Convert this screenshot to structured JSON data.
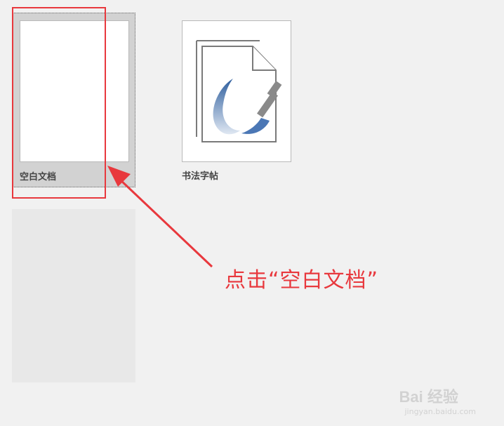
{
  "templates": [
    {
      "label": "空白文档",
      "icon": "blank-document-icon",
      "selected": true
    },
    {
      "label": "书法字帖",
      "icon": "calligraphy-document-icon",
      "selected": false
    }
  ],
  "annotation": {
    "text": "点击“空白文档”",
    "color": "#e8383d"
  },
  "watermark": {
    "main": "Bai 经验",
    "sub": "jingyan.baidu.com"
  },
  "colors": {
    "background": "#f1f1f1",
    "selected_tile": "#d2d2d2",
    "placeholder_tile": "#e8e8e8",
    "brush_blue": "#4b77b5"
  }
}
